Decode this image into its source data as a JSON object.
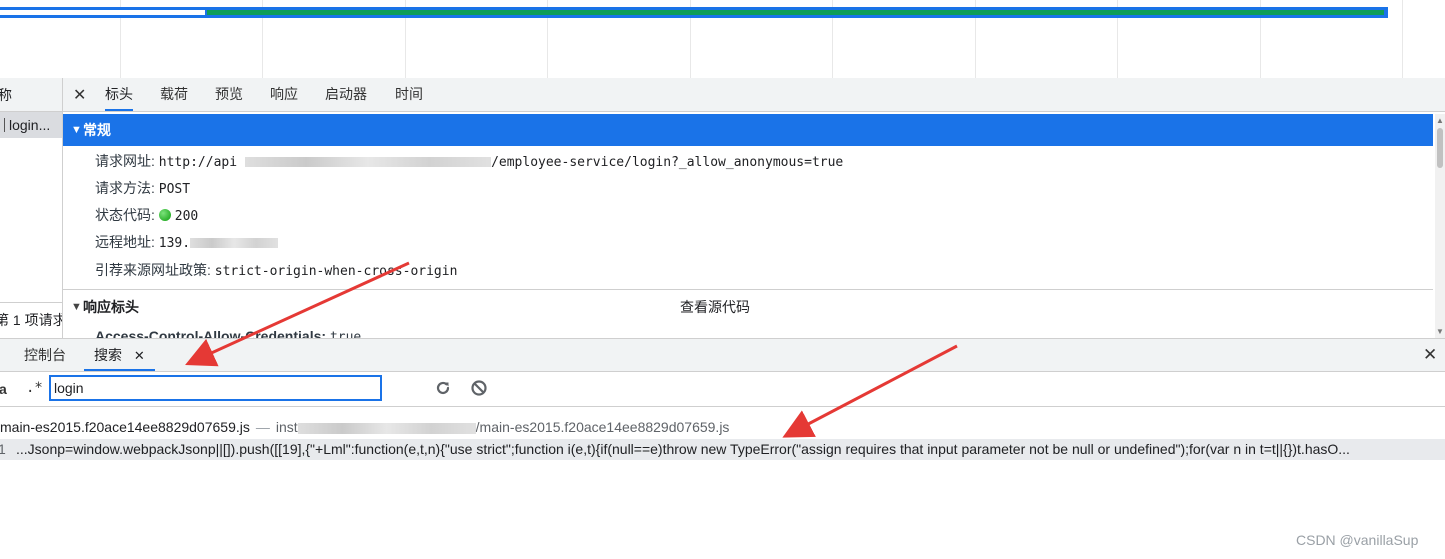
{
  "request_list": {
    "header": "称",
    "selected_item": "login...",
    "footer": "第 1 项请求"
  },
  "detail_tabs": [
    "标头",
    "载荷",
    "预览",
    "响应",
    "启动器",
    "时间"
  ],
  "general": {
    "title": "常规",
    "request_url_label": "请求网址:",
    "request_url_prefix": "http://api",
    "request_url_suffix": "/employee-service/login?_allow_anonymous=true",
    "method_label": "请求方法:",
    "method": "POST",
    "status_label": "状态代码:",
    "status": "200",
    "remote_label": "远程地址:",
    "remote_prefix": "139.",
    "referrer_label": "引荐来源网址政策:",
    "referrer": "strict-origin-when-cross-origin"
  },
  "response_headers": {
    "title": "响应标头",
    "view_source": "查看源代码",
    "first_header": "Access-Control-Allow-Credentials:",
    "first_value": "true"
  },
  "drawer": {
    "tabs": [
      "控制台",
      "搜索"
    ],
    "case_toggle": "a",
    "regex_toggle": ".*",
    "search_value": "login",
    "result_file": "main-es2015.f20ace14ee8829d07659.js",
    "result_path_prefix": "inst",
    "result_path_suffix": "/main-es2015.f20ace14ee8829d07659.js",
    "result_line_number": "1",
    "result_code": "...Jsonp=window.webpackJsonp||[]).push([[19],{\"+Lml\":function(e,t,n){\"use strict\";function i(e,t){if(null==e)throw new TypeError(\"assign requires that input parameter not be null or undefined\");for(var n in t=t||{})t.hasO..."
  },
  "watermark": "CSDN @vanillaSup",
  "colors": {
    "accent": "#1a73e8",
    "timeline_green": "#0f9d58",
    "annotation_red": "#e53935"
  }
}
